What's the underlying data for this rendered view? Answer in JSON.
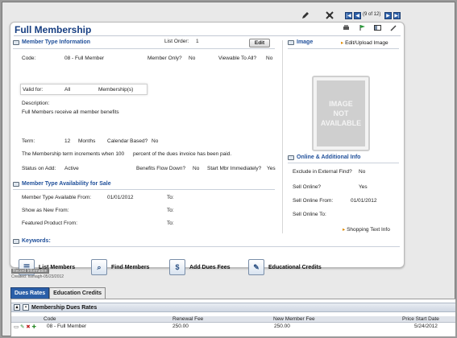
{
  "toolbar": {
    "pager": "(9 of 12)",
    "nav": [
      "|◀",
      "◀",
      "▶",
      "▶|"
    ]
  },
  "card": {
    "title": "Full Membership",
    "list_order_label": "List Order:",
    "list_order_value": "1",
    "edit_label": "Edit"
  },
  "member_info": {
    "heading": "Member Type Information",
    "code_label": "Code:",
    "code_value": "08 - Full Member",
    "member_only_label": "Member Only?",
    "member_only_value": "No",
    "viewable_label": "Viewable To All?",
    "viewable_value": "No",
    "valid_for_label": "Valid for:",
    "valid_for_value": "All",
    "valid_for_unit": "Membership(s)",
    "description_label": "Description:",
    "description_value": "Full Members receive all member benefits",
    "term_label": "Term:",
    "term_value": "12",
    "term_unit": "Months",
    "calendar_label": "Calendar Based?",
    "calendar_value": "No",
    "term_note_a": "The Membership term increments when 100",
    "term_note_b": "percent of the dues invoice has been paid.",
    "status_add_label": "Status on Add:",
    "status_add_value": "Active",
    "benefits_label": "Benefits Flow Down?",
    "benefits_value": "No",
    "start_mbr_label": "Start Mbr Immediately?",
    "start_mbr_value": "Yes"
  },
  "availability": {
    "heading": "Member Type Availability for Sale",
    "from_label": "Member Type Available From:",
    "from_value": "01/01/2012",
    "to_label": "To:",
    "show_new_label": "Show as New From:",
    "show_new_to": "To:",
    "featured_label": "Featured Product From:",
    "featured_to": "To:"
  },
  "keywords": {
    "heading": "Keywords:"
  },
  "image": {
    "heading": "Image",
    "upload_label": "Edit/Upload Image",
    "placeholder_lines": [
      "IMAGE",
      "NOT",
      "AVAILABLE"
    ]
  },
  "online": {
    "heading": "Online & Additional Info",
    "exclude_label": "Exclude in External Find?",
    "exclude_value": "No",
    "sell_online_label": "Sell Online?",
    "sell_online_value": "Yes",
    "sell_from_label": "Sell Online From:",
    "sell_from_value": "01/01/2012",
    "sell_to_label": "Sell Online To:",
    "shopping_label": "Shopping Text Info"
  },
  "actions": {
    "list_members": "List Members",
    "find_members": "Find Members",
    "add_dues": "Add Dues Fees",
    "educational": "Educational Credits"
  },
  "record": {
    "header": "Record Information",
    "created": "Created: hsmagh-05/23/2012"
  },
  "tabs": [
    "Dues Rates",
    "Education Credits"
  ],
  "dues_panel": {
    "title": "Membership Dues Rates",
    "columns": [
      "Code",
      "Renewal Fee",
      "New Member Fee",
      "Price Start Date"
    ],
    "rows": [
      {
        "code": "08 - Full Member",
        "renewal": "250.00",
        "new_member": "250.00",
        "start": "5/24/2012"
      }
    ]
  },
  "colors": {
    "title_blue": "#183f82",
    "section_blue": "#1f4f9a",
    "tab_active": "#2b5fa8"
  }
}
